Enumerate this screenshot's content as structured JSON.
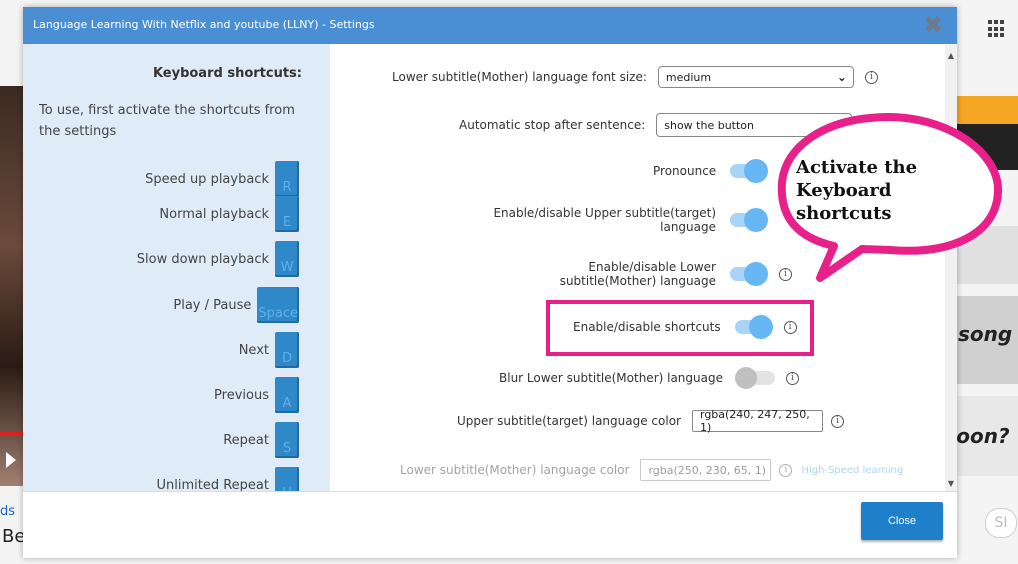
{
  "window": {
    "title": "Language Learning With Netflix and youtube (LLNY) - Settings",
    "close_icon": "✖"
  },
  "background": {
    "left_link": "ds",
    "left_heading": "Be",
    "right_song": "song",
    "right_noon": "noon?",
    "right_pill": "SI"
  },
  "sidebar": {
    "heading": "Keyboard shortcuts:",
    "intro": "To use, first activate the shortcuts from the settings",
    "shortcuts": [
      {
        "label": "Speed up playback",
        "key": "R"
      },
      {
        "label": "Normal playback",
        "key": "E"
      },
      {
        "label": "Slow down playback",
        "key": "W"
      },
      {
        "label": "Play / Pause",
        "key": "Space"
      },
      {
        "label": "Next",
        "key": "D"
      },
      {
        "label": "Previous",
        "key": "A"
      },
      {
        "label": "Repeat",
        "key": "S"
      },
      {
        "label": "Unlimited Repeat",
        "key": "H"
      }
    ]
  },
  "settings": {
    "lower_font_size": {
      "label": "Lower subtitle(Mother) language font size:",
      "value": "medium"
    },
    "auto_stop": {
      "label": "Automatic stop after sentence:",
      "value": "show the button"
    },
    "pronounce": {
      "label": "Pronounce",
      "on": true
    },
    "upper_toggle": {
      "label": "Enable/disable Upper subtitle(target) language",
      "on": true
    },
    "lower_toggle": {
      "label": "Enable/disable Lower subtitle(Mother) language",
      "on": true
    },
    "shortcuts_toggle": {
      "label": "Enable/disable shortcuts",
      "on": true
    },
    "blur_lower": {
      "label": "Blur Lower subtitle(Mother) language",
      "on": false
    },
    "upper_color": {
      "label": "Upper subtitle(target) language color",
      "value": "rgba(240, 247, 250, 1)"
    },
    "lower_color": {
      "label": "Lower subtitle(Mother) language color",
      "value": "rgba(250, 230, 65, 1)",
      "link": "High-Speed learning"
    },
    "info_icon": "i"
  },
  "footer": {
    "close_label": "Close"
  },
  "annotation": {
    "text_line1": "Activate the",
    "text_line2": "Keyboard",
    "text_line3": "shortcuts",
    "color": "#e8208a"
  }
}
